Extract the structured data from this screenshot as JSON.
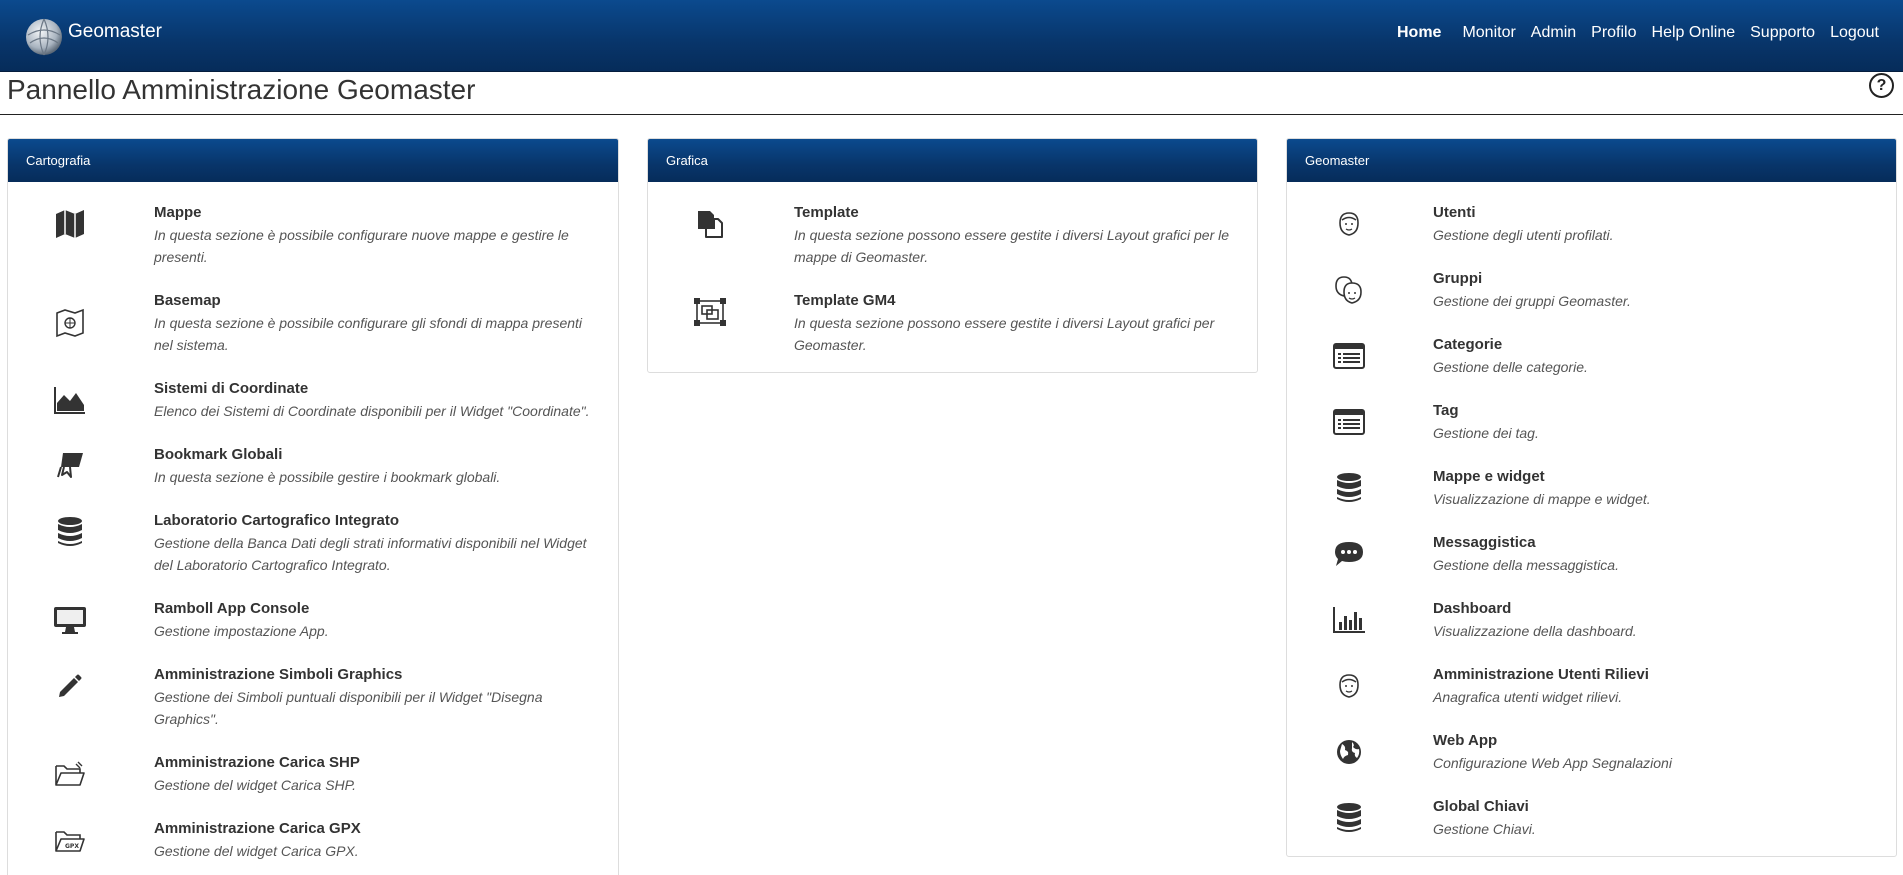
{
  "app": {
    "brand": "Geomaster",
    "nav": [
      "Home",
      "Monitor",
      "Admin",
      "Profilo",
      "Help Online",
      "Supporto",
      "Logout"
    ]
  },
  "page": {
    "title": "Pannello Amministrazione Geomaster",
    "help": "?"
  },
  "panels": [
    {
      "heading": "Cartografia",
      "items": [
        {
          "icon": "map",
          "title": "Mappe",
          "desc": "In questa sezione è possibile configurare nuove mappe e gestire le presenti."
        },
        {
          "icon": "basemap",
          "title": "Basemap",
          "desc": "In questa sezione è possibile configurare gli sfondi di mappa presenti nel sistema."
        },
        {
          "icon": "area-chart",
          "title": "Sistemi di Coordinate",
          "desc": "Elenco dei Sistemi di Coordinate disponibili per il Widget \"Coordinate\"."
        },
        {
          "icon": "bookmark",
          "title": "Bookmark Globali",
          "desc": "In questa sezione è possibile gestire i bookmark globali."
        },
        {
          "icon": "database",
          "title": "Laboratorio Cartografico Integrato",
          "desc": "Gestione della Banca Dati degli strati informativi disponibili nel Widget del Laboratorio Cartografico Integrato."
        },
        {
          "icon": "monitor",
          "title": "Ramboll App Console",
          "desc": "Gestione impostazione App."
        },
        {
          "icon": "pencil",
          "title": "Amministrazione Simboli Graphics",
          "desc": "Gestione dei Simboli puntuali disponibili per il Widget \"Disegna Graphics\"."
        },
        {
          "icon": "folder-open",
          "title": "Amministrazione Carica SHP",
          "desc": "Gestione del widget Carica SHP."
        },
        {
          "icon": "gpx",
          "title": "Amministrazione Carica GPX",
          "desc": "Gestione del widget Carica GPX."
        }
      ]
    },
    {
      "heading": "Grafica",
      "items": [
        {
          "icon": "template",
          "title": "Template",
          "desc": "In questa sezione possono essere gestite i diversi Layout grafici per le mappe di Geomaster."
        },
        {
          "icon": "template-gm4",
          "title": "Template GM4",
          "desc": "In questa sezione possono essere gestite i diversi Layout grafici per Geomaster."
        }
      ]
    },
    {
      "heading": "Geomaster",
      "items": [
        {
          "icon": "user",
          "title": "Utenti",
          "desc": "Gestione degli utenti profilati."
        },
        {
          "icon": "users",
          "title": "Gruppi",
          "desc": "Gestione dei gruppi Geomaster."
        },
        {
          "icon": "list",
          "title": "Categorie",
          "desc": "Gestione delle categorie."
        },
        {
          "icon": "list",
          "title": "Tag",
          "desc": "Gestione dei tag."
        },
        {
          "icon": "database",
          "title": "Mappe e widget",
          "desc": "Visualizzazione di mappe e widget."
        },
        {
          "icon": "comment",
          "title": "Messaggistica",
          "desc": "Gestione della messaggistica."
        },
        {
          "icon": "bar-chart",
          "title": "Dashboard",
          "desc": "Visualizzazione della dashboard."
        },
        {
          "icon": "user",
          "title": "Amministrazione Utenti Rilievi",
          "desc": "Anagrafica utenti widget rilievi."
        },
        {
          "icon": "globe",
          "title": "Web App",
          "desc": "Configurazione Web App Segnalazioni"
        },
        {
          "icon": "database",
          "title": "Global Chiavi",
          "desc": "Gestione Chiavi."
        }
      ]
    }
  ],
  "colors": {
    "navbar": "#08356a",
    "icon": "#333333"
  }
}
